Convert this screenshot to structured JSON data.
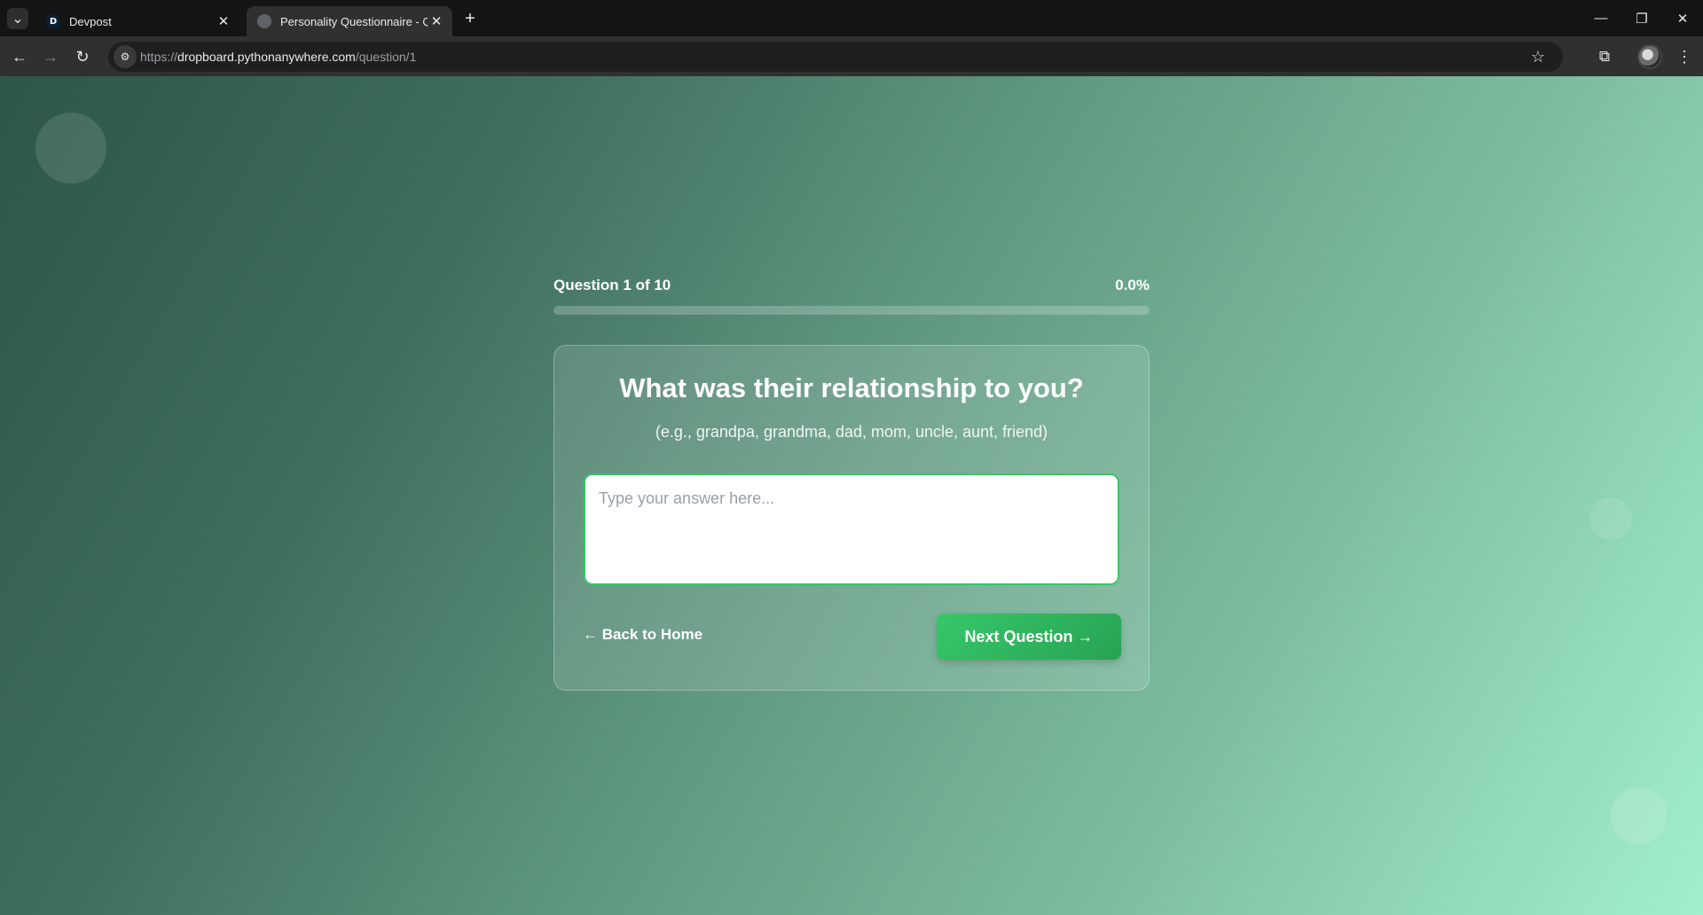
{
  "browser": {
    "tabs": [
      {
        "title": "Devpost",
        "favicon": "D",
        "active": false
      },
      {
        "title": "Personality Questionnaire - Qu",
        "favicon": "globe-icon",
        "active": true
      }
    ],
    "url_scheme": "https://",
    "url_host": "dropboard.pythonanywhere.com",
    "url_path": "/question/1"
  },
  "progress": {
    "label": "Question 1 of 10",
    "percent_text": "0.0%",
    "fraction": 0.0
  },
  "question": {
    "title": "What was their relationship to you?",
    "hint": "(e.g., grandpa, grandma, dad, mom, uncle, aunt, friend)",
    "placeholder": "Type your answer here...",
    "value": ""
  },
  "actions": {
    "back_label": "← Back to Home",
    "next_label": "Next Question →"
  },
  "colors": {
    "accent": "#2fbf62",
    "background_start": "#2c5648",
    "background_end": "#a2efcc"
  }
}
